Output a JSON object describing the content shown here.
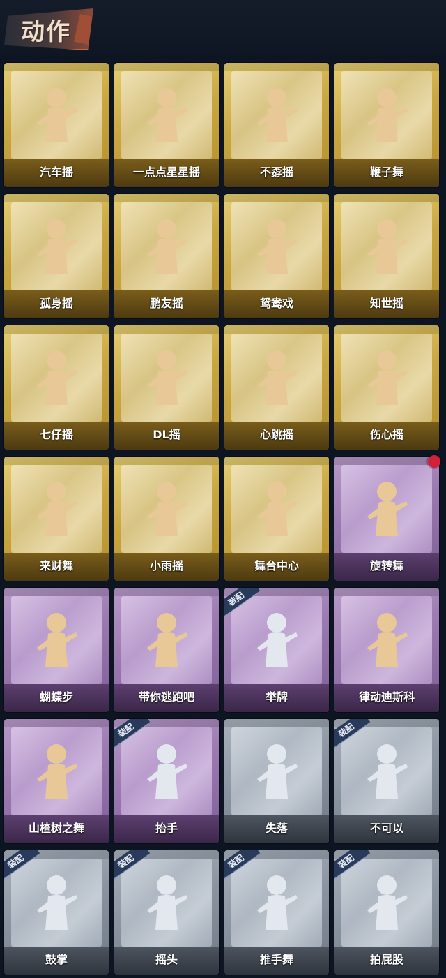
{
  "header": {
    "title": "动作"
  },
  "equip_label": "装配",
  "cards": [
    {
      "label": "汽车摇",
      "tier": "gold",
      "equipped": false,
      "new": false,
      "figure": "gold"
    },
    {
      "label": "一点点星星摇",
      "tier": "gold",
      "equipped": false,
      "new": false,
      "figure": "gold"
    },
    {
      "label": "不孬摇",
      "tier": "gold",
      "equipped": false,
      "new": false,
      "figure": "gold"
    },
    {
      "label": "鞭子舞",
      "tier": "gold",
      "equipped": false,
      "new": false,
      "figure": "gold"
    },
    {
      "label": "孤身摇",
      "tier": "gold",
      "equipped": false,
      "new": false,
      "figure": "gold"
    },
    {
      "label": "鹏友摇",
      "tier": "gold",
      "equipped": false,
      "new": false,
      "figure": "gold"
    },
    {
      "label": "鸳鸯戏",
      "tier": "gold",
      "equipped": false,
      "new": false,
      "figure": "gold"
    },
    {
      "label": "知世摇",
      "tier": "gold",
      "equipped": false,
      "new": false,
      "figure": "gold"
    },
    {
      "label": "七仔摇",
      "tier": "gold",
      "equipped": false,
      "new": false,
      "figure": "gold"
    },
    {
      "label": "DL摇",
      "tier": "gold",
      "equipped": false,
      "new": false,
      "figure": "gold"
    },
    {
      "label": "心跳摇",
      "tier": "gold",
      "equipped": false,
      "new": false,
      "figure": "gold"
    },
    {
      "label": "伤心摇",
      "tier": "gold",
      "equipped": false,
      "new": false,
      "figure": "gold"
    },
    {
      "label": "来财舞",
      "tier": "gold",
      "equipped": false,
      "new": false,
      "figure": "gold"
    },
    {
      "label": "小雨摇",
      "tier": "gold",
      "equipped": false,
      "new": false,
      "figure": "gold"
    },
    {
      "label": "舞台中心",
      "tier": "gold",
      "equipped": false,
      "new": false,
      "figure": "gold"
    },
    {
      "label": "旋转舞",
      "tier": "purple",
      "equipped": false,
      "new": true,
      "figure": "gold"
    },
    {
      "label": "蝴蝶步",
      "tier": "purple",
      "equipped": false,
      "new": false,
      "figure": "gold"
    },
    {
      "label": "带你逃跑吧",
      "tier": "purple",
      "equipped": false,
      "new": false,
      "figure": "gold"
    },
    {
      "label": "举牌",
      "tier": "purple",
      "equipped": true,
      "new": false,
      "figure": "silver"
    },
    {
      "label": "律动迪斯科",
      "tier": "purple",
      "equipped": false,
      "new": false,
      "figure": "gold"
    },
    {
      "label": "山楂树之舞",
      "tier": "purple",
      "equipped": false,
      "new": false,
      "figure": "gold"
    },
    {
      "label": "抬手",
      "tier": "purple",
      "equipped": true,
      "new": false,
      "figure": "silver"
    },
    {
      "label": "失落",
      "tier": "gray",
      "equipped": false,
      "new": false,
      "figure": "silver"
    },
    {
      "label": "不可以",
      "tier": "gray",
      "equipped": true,
      "new": false,
      "figure": "silver"
    },
    {
      "label": "鼓掌",
      "tier": "gray",
      "equipped": true,
      "new": false,
      "figure": "silver"
    },
    {
      "label": "摇头",
      "tier": "gray",
      "equipped": true,
      "new": false,
      "figure": "silver"
    },
    {
      "label": "推手舞",
      "tier": "gray",
      "equipped": true,
      "new": false,
      "figure": "silver"
    },
    {
      "label": "拍屁股",
      "tier": "gray",
      "equipped": true,
      "new": false,
      "figure": "silver"
    }
  ],
  "colors": {
    "gold_figure": "#e8c896",
    "silver_figure": "#e3e7ee",
    "new_dot": "#d1213a"
  }
}
